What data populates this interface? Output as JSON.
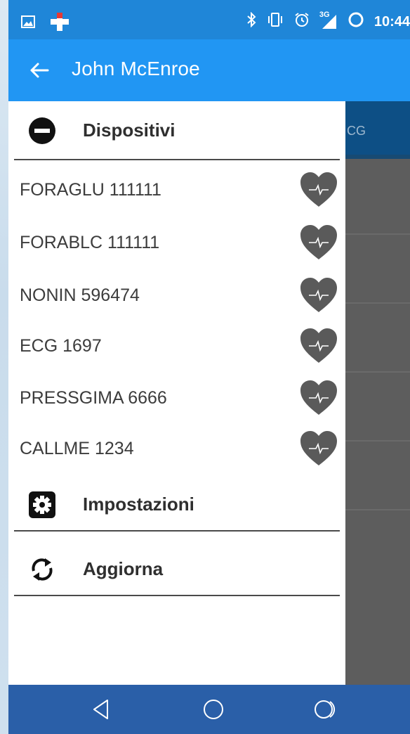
{
  "status_bar": {
    "time": "10:44",
    "network_label": "3G",
    "left_icons": [
      "image-icon",
      "app-plus-icon"
    ],
    "right_icons": [
      "bluetooth-icon",
      "vibrate-icon",
      "alarm-icon",
      "signal-icon",
      "battery-ring-icon"
    ]
  },
  "app_bar": {
    "title": "John McEnroe",
    "back_icon": "back-arrow-icon"
  },
  "background": {
    "tab_partial_label": "CG"
  },
  "drawer": {
    "devices_section": {
      "label": "Dispositivi",
      "icon": "minus-circle-icon"
    },
    "devices": [
      {
        "label": "FORAGLU 111111",
        "icon": "heart-pulse-icon"
      },
      {
        "label": "FORABLC 111111",
        "icon": "heart-pulse-icon"
      },
      {
        "label": "NONIN 596474",
        "icon": "heart-pulse-icon"
      },
      {
        "label": "ECG 1697",
        "icon": "heart-pulse-icon"
      },
      {
        "label": "PRESSGIMA 6666",
        "icon": "heart-pulse-icon"
      },
      {
        "label": "CALLME 1234",
        "icon": "heart-pulse-icon"
      }
    ],
    "settings": {
      "label": "Impostazioni",
      "icon": "settings-gear-icon"
    },
    "refresh": {
      "label": "Aggiorna",
      "icon": "refresh-icon"
    }
  },
  "nav_bar": {
    "buttons": [
      "back-nav-icon",
      "home-nav-icon",
      "recents-nav-icon"
    ]
  },
  "colors": {
    "status_bar": "#1f86d8",
    "app_bar": "#2196f3",
    "drawer_bg": "#ffffff",
    "scrim": "#5d5d5d",
    "nav_bar": "#2a5fa8",
    "heart_icon": "#5a5a5a"
  }
}
